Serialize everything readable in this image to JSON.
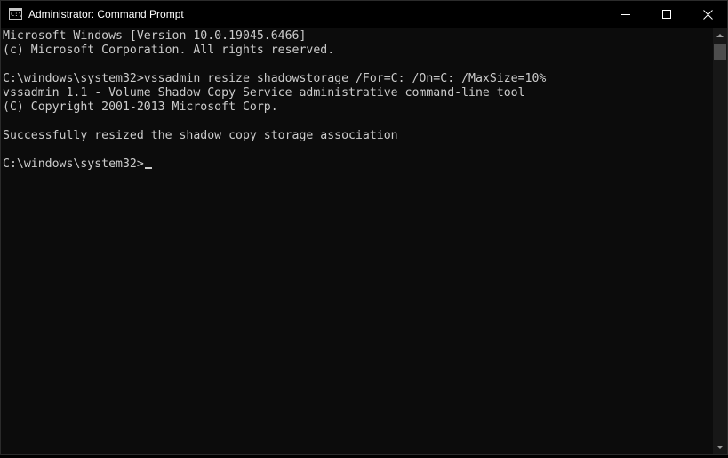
{
  "window": {
    "title": "Administrator: Command Prompt",
    "icon": "cmd-icon",
    "icon_glyph": "C:\\"
  },
  "controls": {
    "minimize": "minimize-icon",
    "maximize": "maximize-icon",
    "close": "close-icon"
  },
  "console": {
    "lines": [
      "Microsoft Windows [Version 10.0.19045.6466]",
      "(c) Microsoft Corporation. All rights reserved.",
      "",
      "C:\\windows\\system32>vssadmin resize shadowstorage /For=C: /On=C: /MaxSize=10%",
      "vssadmin 1.1 - Volume Shadow Copy Service administrative command-line tool",
      "(C) Copyright 2001-2013 Microsoft Corp.",
      "",
      "Successfully resized the shadow copy storage association",
      "",
      "C:\\windows\\system32>"
    ]
  },
  "colors": {
    "titlebar": "#000000",
    "console_bg": "#0c0c0c",
    "console_text": "#cccccc",
    "scrollbar_track": "#171717",
    "scrollbar_thumb": "#4d4d4d"
  }
}
